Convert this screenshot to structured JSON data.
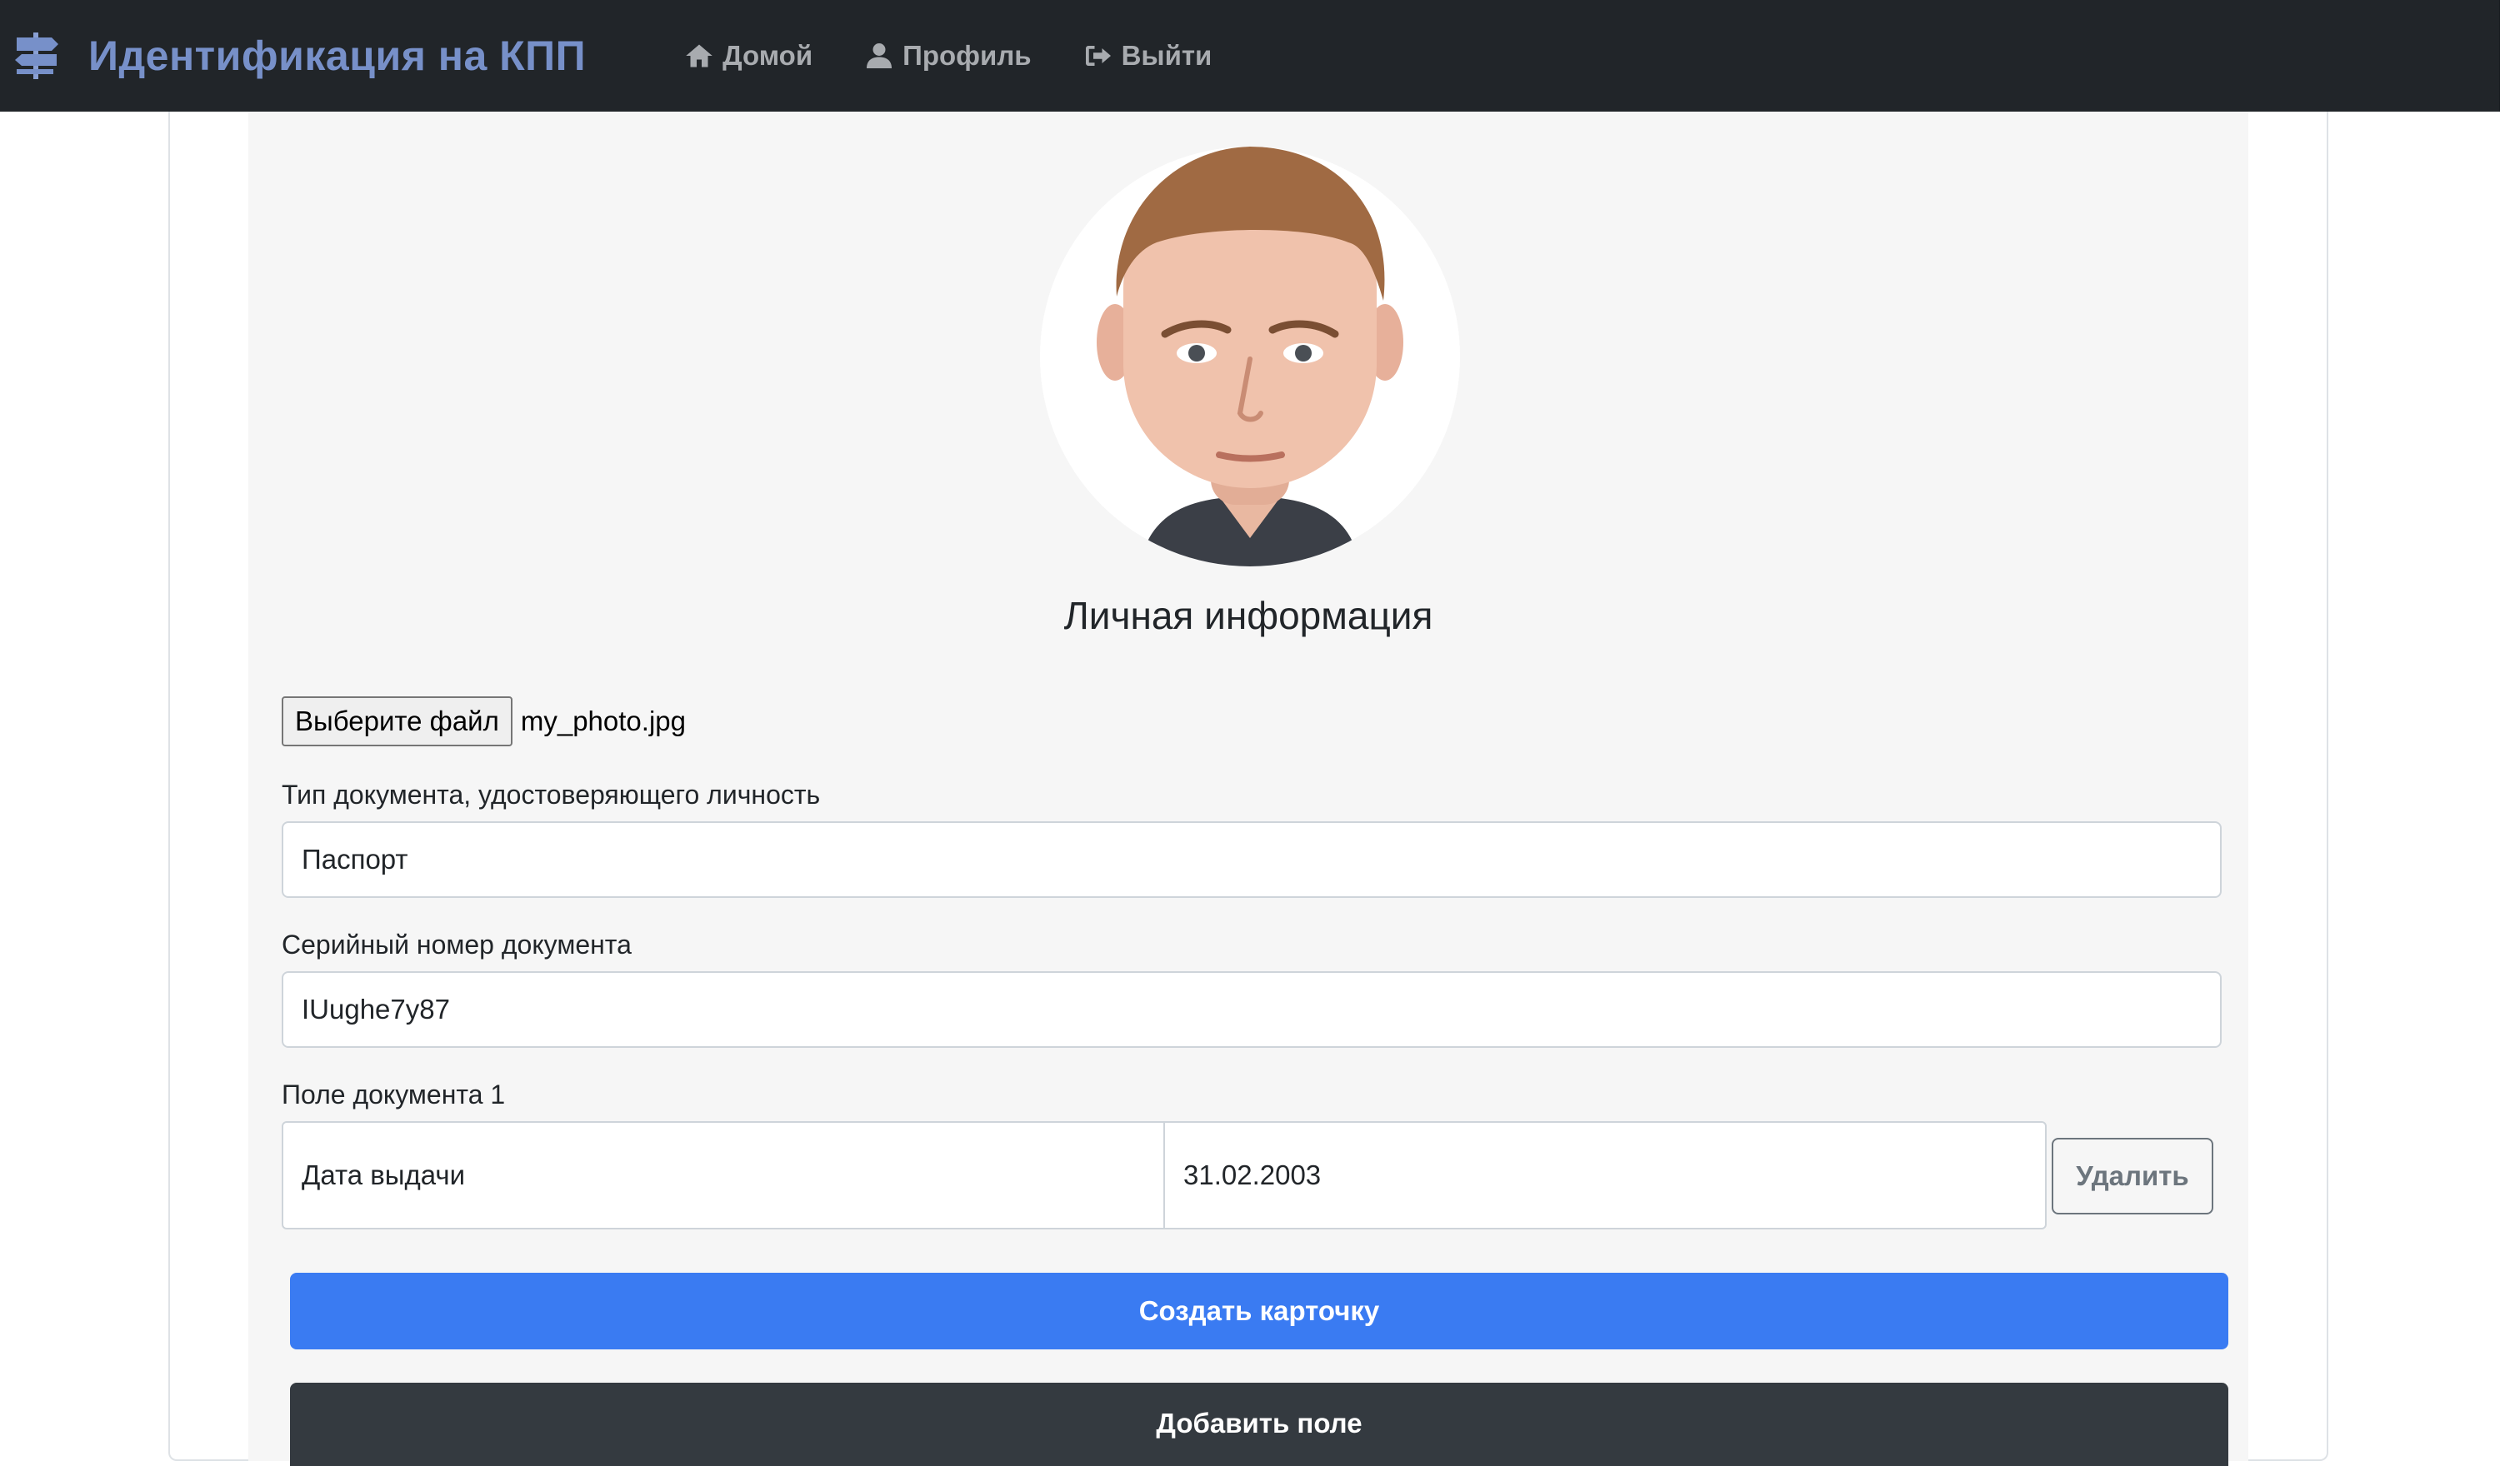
{
  "navbar": {
    "brand_title": "Идентификация на КПП",
    "links": [
      {
        "label": "Домой",
        "icon": "home-icon"
      },
      {
        "label": "Профиль",
        "icon": "user-icon"
      },
      {
        "label": "Выйти",
        "icon": "sign-out-icon"
      }
    ]
  },
  "profile": {
    "section_title": "Личная информация",
    "file_input": {
      "button_label": "Выберите файл",
      "file_name": "my_photo.jpg"
    },
    "document_type": {
      "label": "Тип документа, удостоверяющего личность",
      "value": "Паспорт"
    },
    "serial_number": {
      "label": "Серийный номер документа",
      "value": "IUughe7y87"
    },
    "extra_field": {
      "label": "Поле документа 1",
      "name": "Дата выдачи",
      "value": "31.02.2003",
      "delete_label": "Удалить"
    },
    "create_button_label": "Создать карточку",
    "add_field_button_label": "Добавить поле"
  },
  "colors": {
    "navbar_bg": "#212529",
    "brand": "#7790c9",
    "primary": "#3a7bf2",
    "dark_button": "#343a40"
  }
}
